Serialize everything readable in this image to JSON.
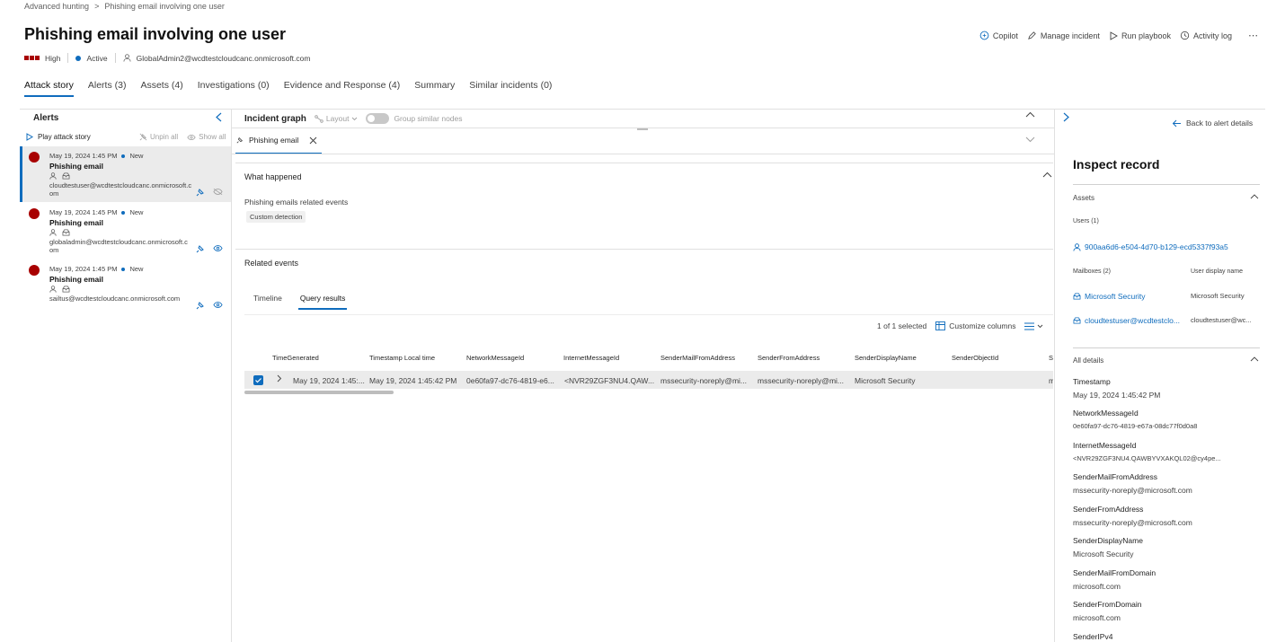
{
  "breadcrumb": {
    "root": "Advanced hunting",
    "current": "Phishing email involving one user"
  },
  "title": "Phishing email involving one user",
  "meta": {
    "severity": "High",
    "status": "Active",
    "assigned_to": "GlobalAdmin2@wcdtestcloudcanc.onmicrosoft.com"
  },
  "actions": {
    "copilot": "Copilot",
    "manage": "Manage incident",
    "playbook": "Run playbook",
    "activity": "Activity log",
    "more": "⋯"
  },
  "tabs": [
    "Attack story",
    "Alerts (3)",
    "Assets (4)",
    "Investigations (0)",
    "Evidence and Response (4)",
    "Summary",
    "Similar incidents (0)"
  ],
  "alerts_panel": {
    "title": "Alerts",
    "play": "Play attack story",
    "unpin_all": "Unpin all",
    "show_all": "Show all",
    "items": [
      {
        "time": "May 19, 2024 1:45 PM",
        "status": "New",
        "title": "Phishing email",
        "user": "cloudtestuser@wcdtestcloudcanc.onmicrosoft.com"
      },
      {
        "time": "May 19, 2024 1:45 PM",
        "status": "New",
        "title": "Phishing email",
        "user": "globaladmin@wcdtestcloudcanc.onmicrosoft.com"
      },
      {
        "time": "May 19, 2024 1:45 PM",
        "status": "New",
        "title": "Phishing email",
        "user": "sailtus@wcdtestcloudcanc.onmicrosoft.com"
      }
    ]
  },
  "graph": {
    "title": "Incident graph",
    "layout": "Layout",
    "group": "Group similar nodes"
  },
  "detail": {
    "tab": "Phishing email",
    "what_happened": "What happened",
    "events_desc": "Phishing emails related events",
    "tag": "Custom detection",
    "related": "Related events",
    "subtabs": [
      "Timeline",
      "Query results"
    ],
    "selected": "1 of 1 selected",
    "customize": "Customize columns",
    "columns": [
      "TimeGenerated",
      "Timestamp Local time",
      "NetworkMessageId",
      "InternetMessageId",
      "SenderMailFromAddress",
      "SenderFromAddress",
      "SenderDisplayName",
      "SenderObjectId",
      "Se"
    ],
    "row": [
      "May 19, 2024 1:45:...",
      "May 19, 2024 1:45:42 PM",
      "0e60fa97-dc76-4819-e6...",
      "<NVR29ZGF3NU4.QAW...",
      "mssecurity-noreply@mi...",
      "mssecurity-noreply@mi...",
      "Microsoft Security",
      "",
      "m"
    ]
  },
  "inspect": {
    "back": "Back to alert details",
    "title": "Inspect record",
    "assets": "Assets",
    "users_label": "Users (1)",
    "user_id": "900aa6d6-e504-4d70-b129-ecd5337f93a5",
    "mailboxes_label": "Mailboxes (2)",
    "display_name_label": "User display name",
    "mailboxes": [
      {
        "name": "Microsoft Security",
        "display": "Microsoft Security"
      },
      {
        "name": "cloudtestuser@wcdtestclo...",
        "display": "cloudtestuser@wc..."
      }
    ],
    "all_details": "All details",
    "details": [
      {
        "k": "Timestamp",
        "v": "May 19, 2024 1:45:42 PM"
      },
      {
        "k": "NetworkMessageId",
        "v": "0e60fa97-dc76-4819-e67a-08dc77f0d0a8"
      },
      {
        "k": "InternetMessageId",
        "v": "<NVR29ZGF3NU4.QAWBYVXAKQL02@cy4pe..."
      },
      {
        "k": "SenderMailFromAddress",
        "v": "mssecurity-noreply@microsoft.com"
      },
      {
        "k": "SenderFromAddress",
        "v": "mssecurity-noreply@microsoft.com"
      },
      {
        "k": "SenderDisplayName",
        "v": "Microsoft Security"
      },
      {
        "k": "SenderMailFromDomain",
        "v": "microsoft.com"
      },
      {
        "k": "SenderFromDomain",
        "v": "microsoft.com"
      },
      {
        "k": "SenderIPv4",
        "v": ""
      }
    ]
  },
  "colors": {
    "accent": "#0f6cbd",
    "severity_high": "#a80000",
    "selected_row": "#ebebeb"
  }
}
